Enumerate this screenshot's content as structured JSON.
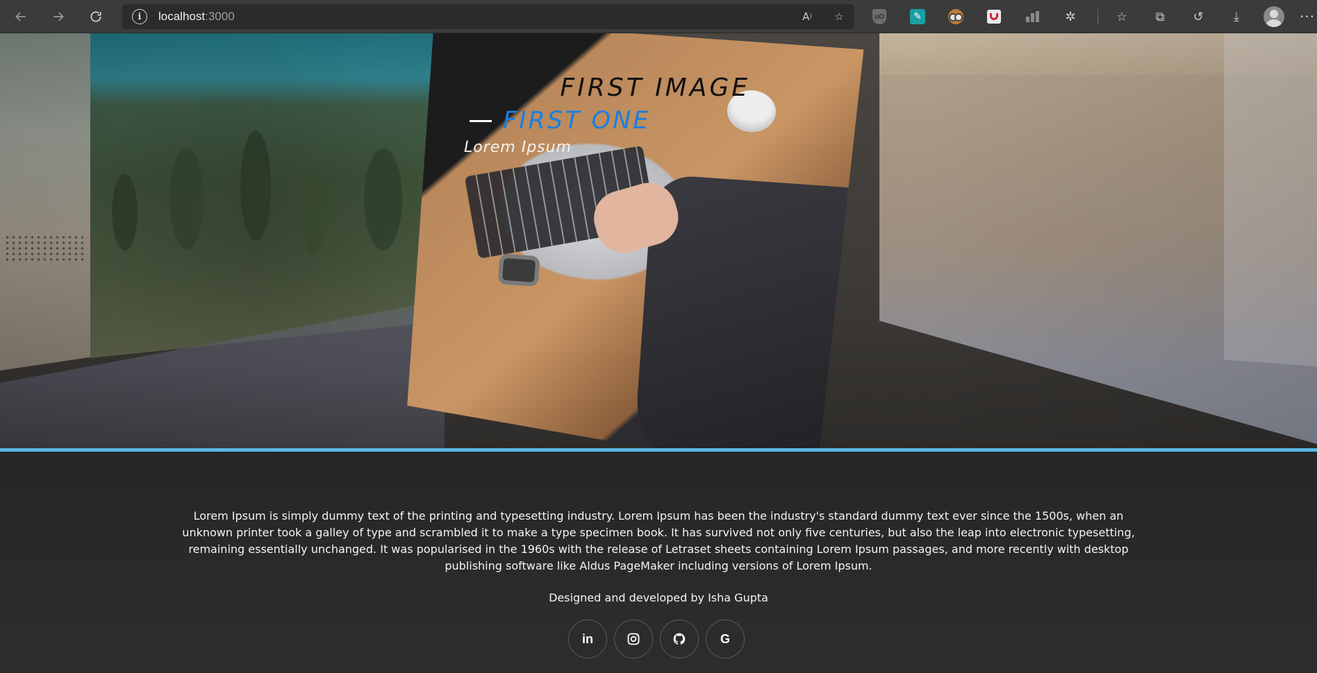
{
  "browser": {
    "url_host": "localhost",
    "url_port": ":3000"
  },
  "slider": {
    "caption_title": "FIRST IMAGE",
    "caption_subtitle": "FIRST ONE",
    "caption_description": "Lorem Ipsum"
  },
  "footer": {
    "description": "Lorem Ipsum is simply dummy text of the printing and typesetting industry. Lorem Ipsum has been the industry's standard dummy text ever since the 1500s, when an unknown printer took a galley of type and scrambled it to make a type specimen book. It has survived not only five centuries, but also the leap into electronic typesetting, remaining essentially unchanged. It was popularised in the 1960s with the release of Letraset sheets containing Lorem Ipsum passages, and more recently with desktop publishing software like Aldus PageMaker including versions of Lorem Ipsum.",
    "credit": "Designed and developed by Isha Gupta",
    "socials": [
      {
        "icon": "linkedin-icon",
        "label": "in"
      },
      {
        "icon": "instagram-icon",
        "label": ""
      },
      {
        "icon": "github-icon",
        "label": ""
      },
      {
        "icon": "google-icon",
        "label": "G"
      }
    ]
  },
  "colors": {
    "accent_line": "#57b7e6",
    "subtitle_blue": "#1a7fe0",
    "footer_bg": "#2b2b2b"
  }
}
